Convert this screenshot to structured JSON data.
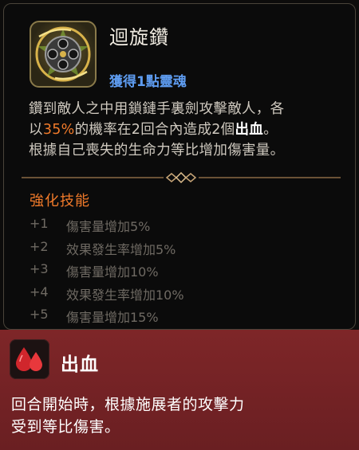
{
  "skill": {
    "name": "迴旋鑽",
    "subtitle": "獲得1點靈魂",
    "desc_line1": "鑽到敵人之中用鎖鏈手裏劍攻擊敵人，各",
    "desc_line2_pre": "以",
    "desc_line2_pct": "35%",
    "desc_line2_mid": "的機率在2回合內造成2個",
    "desc_line2_kw": "出血",
    "desc_line2_post": "。",
    "desc_line3": "根據自己喪失的生命力等比增加傷害量。",
    "icon": "spinning-shuriken-icon"
  },
  "enhancements": {
    "heading": "強化技能",
    "items": [
      {
        "level": "+1",
        "text": "傷害量增加5%"
      },
      {
        "level": "+2",
        "text": "效果發生率增加5%"
      },
      {
        "level": "+3",
        "text": "傷害量增加10%"
      },
      {
        "level": "+4",
        "text": "效果發生率增加10%"
      },
      {
        "level": "+5",
        "text": "傷害量增加15%"
      }
    ]
  },
  "status": {
    "name": "出血",
    "icon": "blood-drops-icon",
    "desc_line1": "回合開始時，根據施展者的攻擊力",
    "desc_line2": "受到等比傷害。"
  },
  "colors": {
    "accent_orange": "#f07a2a",
    "subtitle_blue": "#5e9cf0",
    "status_red": "#7e2628"
  }
}
